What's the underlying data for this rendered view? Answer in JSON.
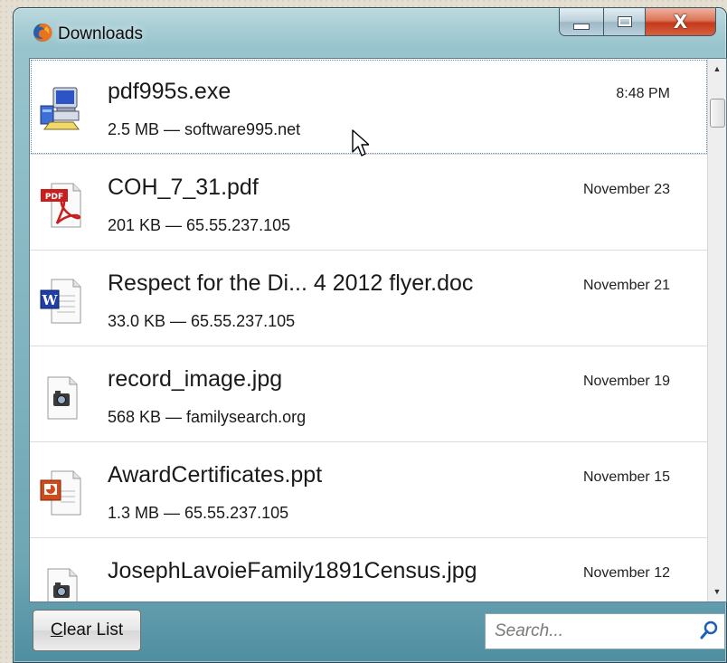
{
  "window": {
    "title": "Downloads",
    "app_icon": "firefox-icon"
  },
  "downloads": [
    {
      "name": "pdf995s.exe",
      "detail": "2.5 MB — software995.net",
      "date": "8:48 PM",
      "icon": "executable-installer-icon"
    },
    {
      "name": "COH_7_31.pdf",
      "detail": "201 KB — 65.55.237.105",
      "date": "November 23",
      "icon": "pdf-file-icon"
    },
    {
      "name": "Respect for the Di... 4 2012 flyer.doc",
      "detail": "33.0 KB — 65.55.237.105",
      "date": "November 21",
      "icon": "word-document-icon"
    },
    {
      "name": "record_image.jpg",
      "detail": "568 KB — familysearch.org",
      "date": "November 19",
      "icon": "image-file-icon"
    },
    {
      "name": "AwardCertificates.ppt",
      "detail": "1.3 MB — 65.55.237.105",
      "date": "November 15",
      "icon": "powerpoint-file-icon"
    },
    {
      "name": "JosephLavoieFamily1891Census.jpg",
      "detail": "",
      "date": "November 12",
      "icon": "image-file-icon"
    }
  ],
  "footer": {
    "clear_button_accesskey": "C",
    "clear_button_rest": "lear List",
    "search_placeholder": "Search..."
  },
  "colors": {
    "frame_accent": "#86b8c3",
    "close_button": "#c4391a",
    "pdf_red": "#c81e1e",
    "word_blue": "#1f3fa6",
    "ppt_orange": "#d24a1b"
  }
}
